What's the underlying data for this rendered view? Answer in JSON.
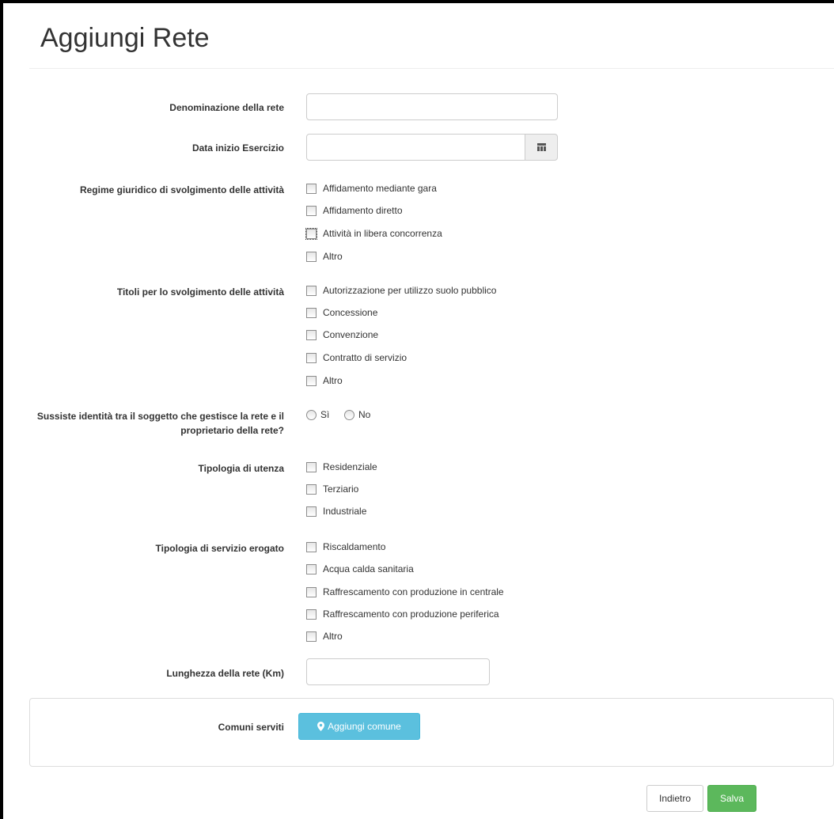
{
  "page": {
    "title": "Aggiungi Rete"
  },
  "form": {
    "denominazione": {
      "label": "Denominazione della rete",
      "value": ""
    },
    "data_inizio": {
      "label": "Data inizio Esercizio",
      "value": "",
      "icon": "calendar-icon"
    },
    "regime": {
      "label": "Regime giuridico di svolgimento delle attività",
      "options": [
        "Affidamento mediante gara",
        "Affidamento diretto",
        "Attività in libera concorrenza",
        "Altro"
      ]
    },
    "titoli": {
      "label": "Titoli per lo svolgimento delle attività",
      "options": [
        "Autorizzazione per utilizzo suolo pubblico",
        "Concessione",
        "Convenzione",
        "Contratto di servizio",
        "Altro"
      ]
    },
    "identita": {
      "label": "Sussiste identità tra il soggetto che gestisce la rete e il proprietario della rete?",
      "options": [
        "Sì",
        "No"
      ]
    },
    "utenza": {
      "label": "Tipologia di utenza",
      "options": [
        "Residenziale",
        "Terziario",
        "Industriale"
      ]
    },
    "servizio": {
      "label": "Tipologia di servizio erogato",
      "options": [
        "Riscaldamento",
        "Acqua calda sanitaria",
        "Raffrescamento con produzione in centrale",
        "Raffrescamento con produzione periferica",
        "Altro"
      ]
    },
    "lunghezza": {
      "label": "Lunghezza della rete (Km)",
      "value": ""
    },
    "comuni": {
      "label": "Comuni serviti",
      "button_label": "Aggiungi comune",
      "icon": "map-marker-icon"
    }
  },
  "actions": {
    "back_label": "Indietro",
    "save_label": "Salva"
  },
  "colors": {
    "info": "#5bc0de",
    "success": "#5cb85c",
    "border": "#cccccc"
  }
}
